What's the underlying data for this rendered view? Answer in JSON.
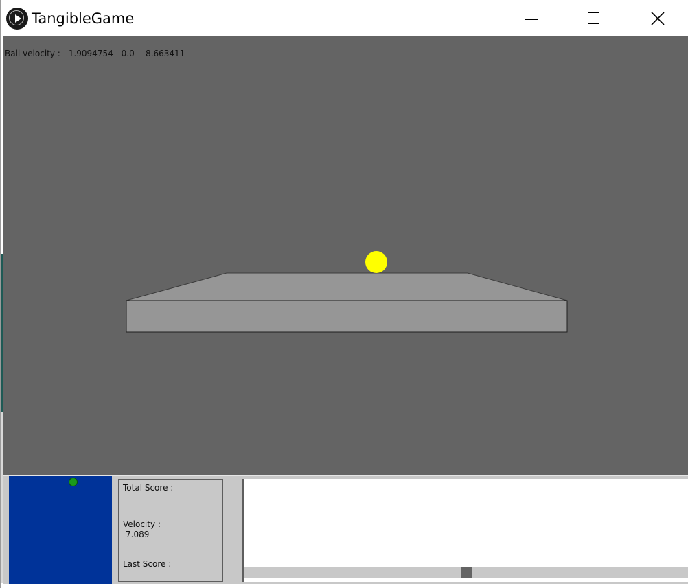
{
  "window": {
    "title": "TangibleGame",
    "icon": "processing-play-icon",
    "controls": [
      "minimize-icon",
      "maximize-icon",
      "close-icon"
    ]
  },
  "scene": {
    "background": "#646464",
    "velocity_label": "Ball velocity :",
    "velocity_value": "1.9094754 - 0.0 - -8.663411",
    "board_color": "#969696",
    "ball_color": "#ffff00"
  },
  "hud": {
    "background": "#c8c8c8",
    "minimap": {
      "background": "#003399",
      "ball_color": "#1a9a1a"
    },
    "scoreboard": {
      "total_score_label": "Total Score :",
      "total_score_value": "",
      "velocity_label": "Velocity :",
      "velocity_value": "7.089",
      "last_score_label": "Last Score :",
      "last_score_value": ""
    },
    "score_chart": {
      "background": "#ffffff"
    },
    "scrollbar": {
      "track_color": "#c8c8c8",
      "handle_color": "#646464",
      "position": 0.5
    }
  }
}
